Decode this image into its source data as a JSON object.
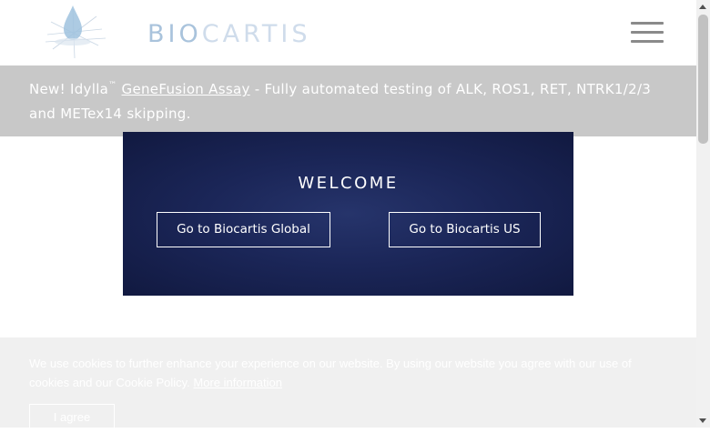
{
  "header": {
    "logo": {
      "part1": "BIO",
      "part2": "CARTIS",
      "icon": "drop-star-logo-icon"
    },
    "menu_icon": "hamburger-menu-icon"
  },
  "banner": {
    "prefix": "New! Idylla",
    "trademark": "™",
    "link": "GeneFusion Assay",
    "suffix": " - Fully automated testing of ALK, ROS1, RET, NTRK1/2/3 and METex14 skipping."
  },
  "modal": {
    "title": "WELCOME",
    "global_button": "Go to Biocartis Global",
    "us_button": "Go to Biocartis US"
  },
  "cookie": {
    "text": "We use cookies to further enhance your experience on our website. By using our website you agree with our use of cookies and our Cookie Policy.",
    "more_link": "More information",
    "agree_button": "I agree"
  },
  "colors": {
    "banner_bg": "#c8c8c8",
    "modal_bg": "#1b2658",
    "logo_bio": "#a9c3dc",
    "logo_cartis": "#cfdceb"
  }
}
